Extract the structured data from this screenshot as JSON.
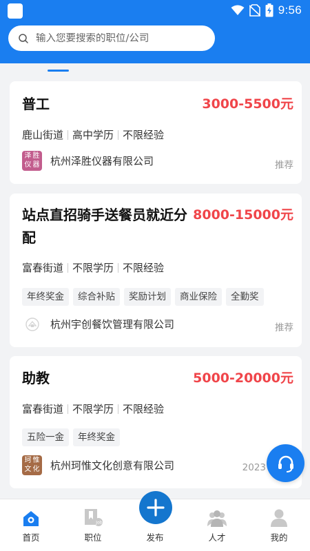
{
  "status": {
    "time": "9:56"
  },
  "search": {
    "placeholder": "输入您要搜索的职位/公司"
  },
  "jobs": [
    {
      "title": "普工",
      "salary": "3000-5500元",
      "reqs": [
        "鹿山街道",
        "高中学历",
        "不限经验"
      ],
      "tags": [],
      "company": "杭州泽胜仪器有限公司",
      "logo": [
        "泽",
        "胜",
        "仪",
        "器"
      ],
      "badge": "推荐"
    },
    {
      "title_line1": "站点直招骑手送餐员就近分",
      "title_line2": "配",
      "salary": "8000-15000元",
      "reqs": [
        "富春街道",
        "不限学历",
        "不限经验"
      ],
      "tags": [
        "年终奖金",
        "综合补贴",
        "奖励计划",
        "商业保险",
        "全勤奖"
      ],
      "company": "杭州宇创餐饮管理有限公司",
      "badge": "推荐"
    },
    {
      "title": "助教",
      "salary": "5000-20000元",
      "reqs": [
        "富春街道",
        "不限学历",
        "不限经验"
      ],
      "tags": [
        "五险一金",
        "年终奖金"
      ],
      "company": "杭州珂惟文化创意有限公司",
      "logo": [
        "珂",
        "惟",
        "文",
        "化"
      ],
      "badge": "2023"
    }
  ],
  "nav": [
    {
      "label": "首页",
      "icon": "home-icon"
    },
    {
      "label": "职位",
      "icon": "job-icon"
    },
    {
      "label": "发布",
      "icon": "plus-icon"
    },
    {
      "label": "人才",
      "icon": "people-icon"
    },
    {
      "label": "我的",
      "icon": "user-icon"
    }
  ],
  "colors": {
    "primary": "#1a7ef0",
    "salary": "#f0454a"
  }
}
